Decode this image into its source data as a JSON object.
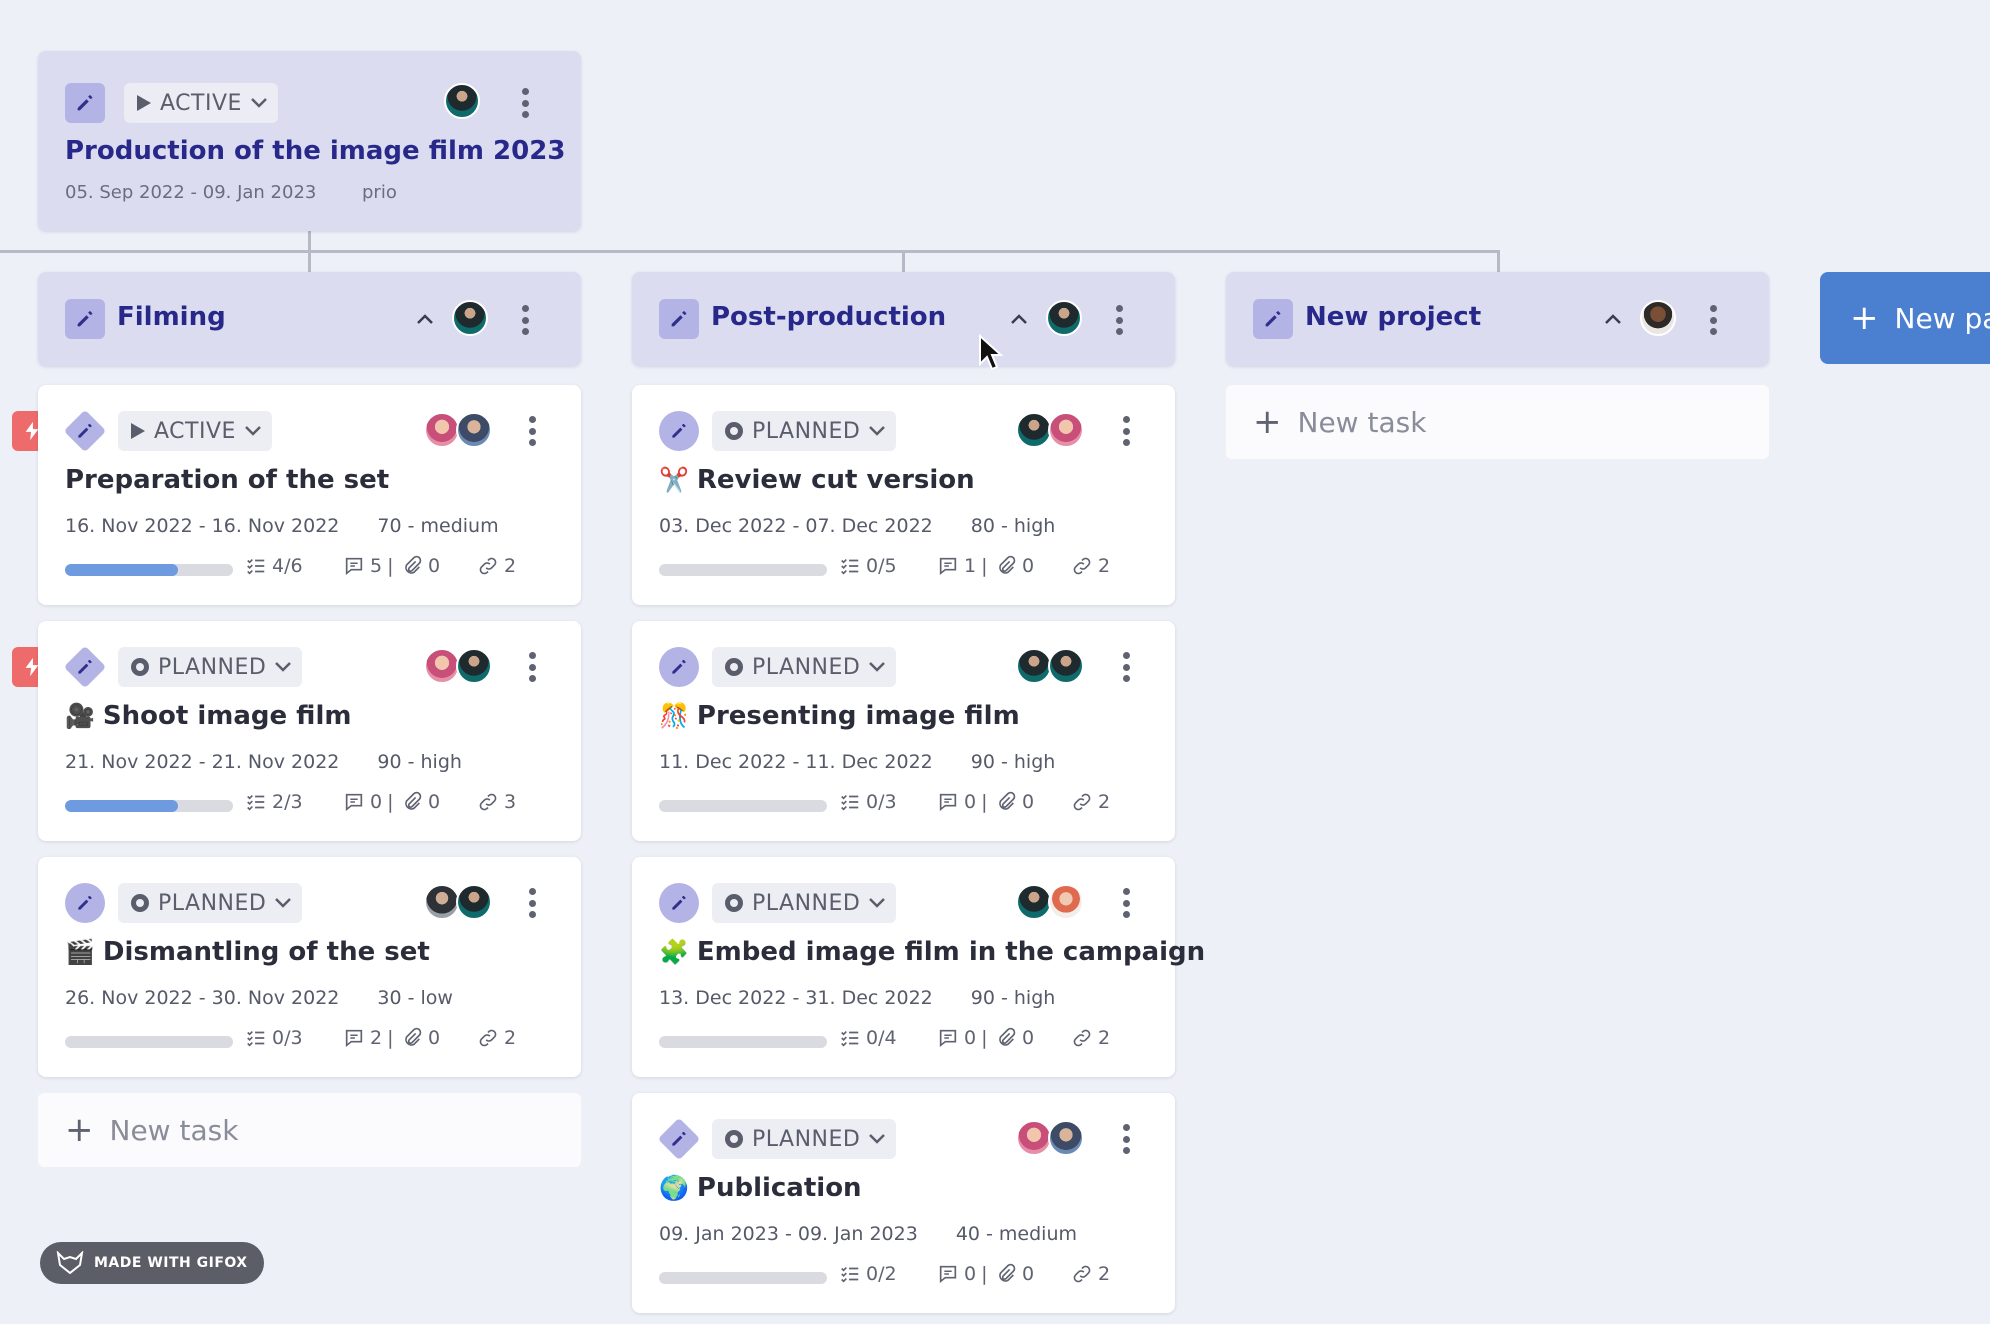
{
  "project": {
    "status": "ACTIVE",
    "title": "Production of the image film 2023",
    "dates": "05. Sep 2022 - 09. Jan 2023",
    "prio": "prio"
  },
  "phases": [
    {
      "title": "Filming"
    },
    {
      "title": "Post-production"
    },
    {
      "title": "New project"
    }
  ],
  "new_phase_label": "New pa",
  "new_task_label": "New task",
  "columns": [
    {
      "tasks": [
        {
          "status": "ACTIVE",
          "emoji": "",
          "title": "Preparation of the set",
          "dates": "16. Nov 2022 - 16. Nov 2022",
          "prio": "70 - medium",
          "progress": 0.67,
          "checklist": "4/6",
          "comments": "5",
          "attachments": "0",
          "links": "2"
        },
        {
          "status": "PLANNED",
          "emoji": "🎥",
          "title": "Shoot image film",
          "dates": "21. Nov 2022 - 21. Nov 2022",
          "prio": "90 - high",
          "progress": 0.67,
          "checklist": "2/3",
          "comments": "0",
          "attachments": "0",
          "links": "3"
        },
        {
          "status": "PLANNED",
          "emoji": "🎬",
          "title": "Dismantling of the set",
          "dates": "26. Nov 2022 - 30. Nov 2022",
          "prio": "30 - low",
          "progress": 0,
          "checklist": "0/3",
          "comments": "2",
          "attachments": "0",
          "links": "2"
        }
      ]
    },
    {
      "tasks": [
        {
          "status": "PLANNED",
          "emoji": "✂️",
          "title": "Review cut version",
          "dates": "03. Dec 2022 - 07. Dec 2022",
          "prio": "80 - high",
          "progress": 0,
          "checklist": "0/5",
          "comments": "1",
          "attachments": "0",
          "links": "2"
        },
        {
          "status": "PLANNED",
          "emoji": "🎊",
          "title": "Presenting image film",
          "dates": "11. Dec 2022 - 11. Dec 2022",
          "prio": "90 - high",
          "progress": 0,
          "checklist": "0/3",
          "comments": "0",
          "attachments": "0",
          "links": "2"
        },
        {
          "status": "PLANNED",
          "emoji": "🧩",
          "title": "Embed image film in the campaign",
          "dates": "13. Dec 2022 - 31. Dec 2022",
          "prio": "90 - high",
          "progress": 0,
          "checklist": "0/4",
          "comments": "0",
          "attachments": "0",
          "links": "2"
        },
        {
          "status": "PLANNED",
          "emoji": "🌍",
          "title": "Publication",
          "dates": "09. Jan 2023 - 09. Jan 2023",
          "prio": "40 - medium",
          "progress": 0,
          "checklist": "0/2",
          "comments": "0",
          "attachments": "0",
          "links": "2"
        }
      ]
    }
  ],
  "watermark": "MADE WITH GIFOX",
  "colors": {
    "accent": "#27288a",
    "phase_bg": "#dcdcf0",
    "urgent": "#ee6b6b",
    "progress": "#6e9ae0",
    "new_phase": "#4b7fd0"
  }
}
